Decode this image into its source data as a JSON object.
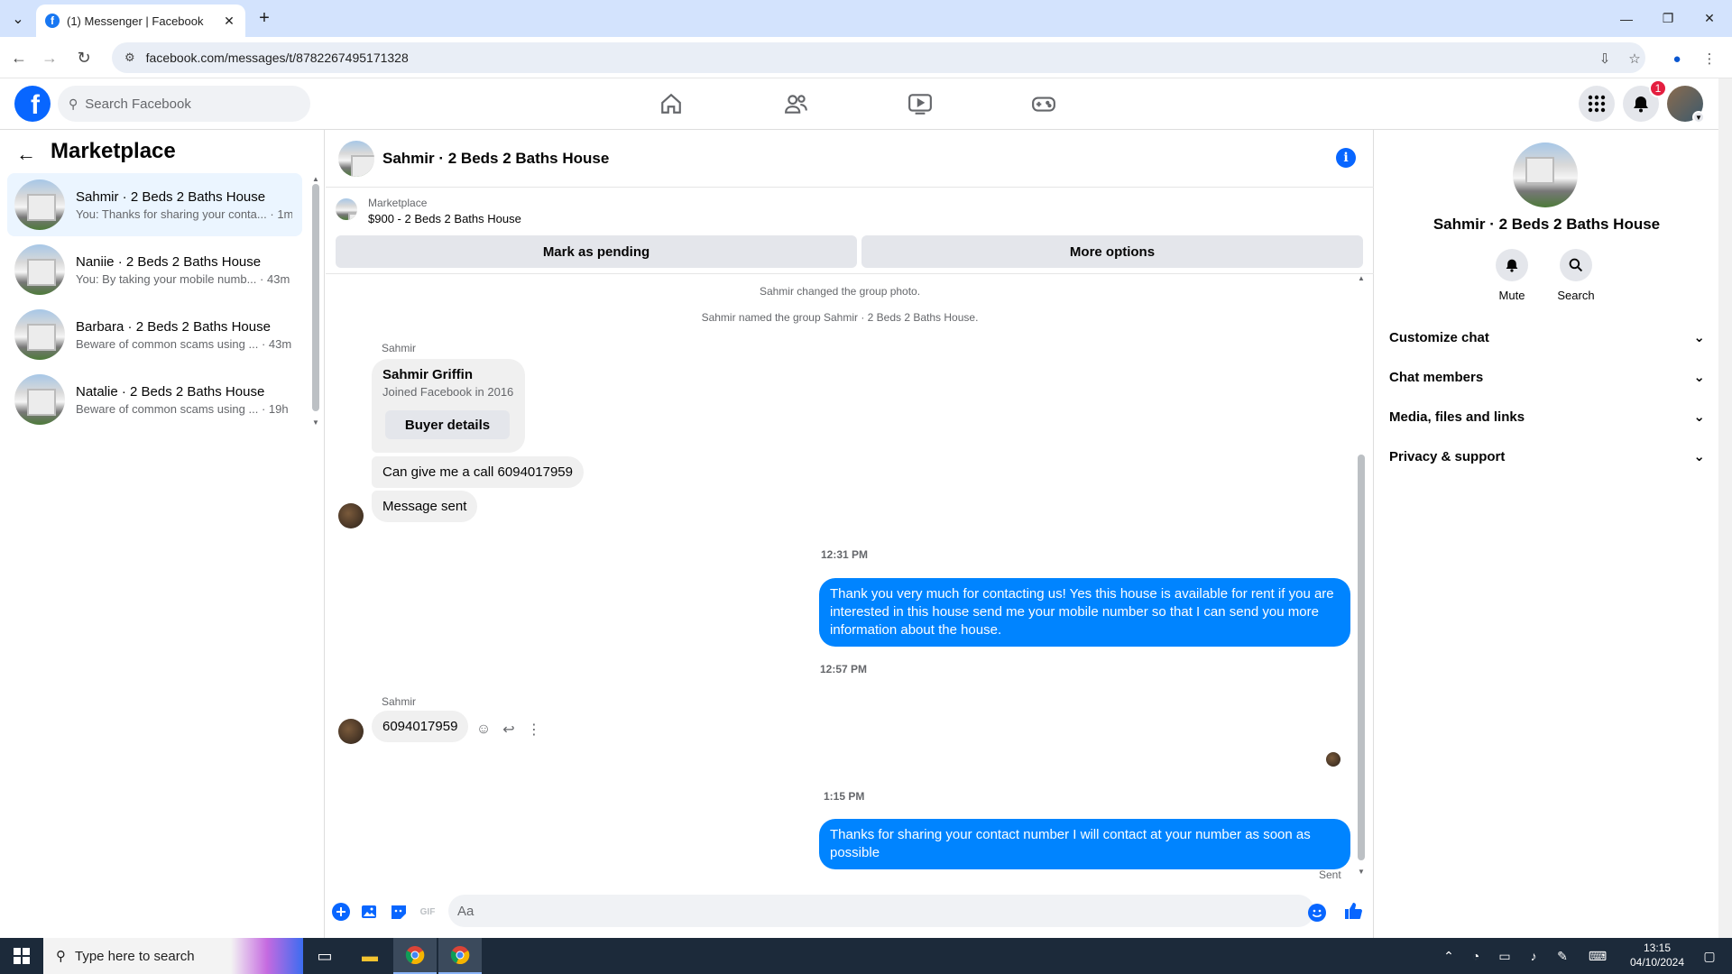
{
  "browser": {
    "tab_title": "(1) Messenger | Facebook",
    "url": "facebook.com/messages/t/8782267495171328"
  },
  "fb_header": {
    "search_placeholder": "Search Facebook",
    "notification_count": "1"
  },
  "left_panel": {
    "heading": "Marketplace",
    "conversations": [
      {
        "name": "Sahmir · 2 Beds 2 Baths House",
        "preview": "You: Thanks for sharing your conta...",
        "time": "· 1m",
        "active": true
      },
      {
        "name": "Naniie · 2 Beds 2 Baths House",
        "preview": "You: By taking your mobile numb...",
        "time": "· 43m",
        "active": false
      },
      {
        "name": "Barbara · 2 Beds 2 Baths House",
        "preview": "Beware of common scams using ...",
        "time": "· 43m",
        "active": false
      },
      {
        "name": "Natalie · 2 Beds 2 Baths House",
        "preview": "Beware of common scams using ...",
        "time": "· 19h",
        "active": false
      }
    ]
  },
  "chat": {
    "title": "Sahmir · 2 Beds 2 Baths House",
    "marketplace_label": "Marketplace",
    "listing": "$900 - 2 Beds 2 Baths House",
    "mark_pending": "Mark as pending",
    "more_options": "More options",
    "sys_photo": "Sahmir changed the group photo.",
    "sys_named": "Sahmir named the group Sahmir · 2 Beds 2 Baths House.",
    "sender_1": "Sahmir",
    "card_name": "Sahmir Griffin",
    "card_joined": "Joined Facebook in 2016",
    "buyer_details": "Buyer details",
    "msg_call": "Can give me a call 6094017959",
    "msg_sent": "Message sent",
    "ts_1": "12:31 PM",
    "mine_1": "Thank you very much for contacting us! Yes this house is available for rent if you are interested in this house send me your mobile number so that I can send you more information about the house.",
    "ts_2": "12:57 PM",
    "sender_2": "Sahmir",
    "msg_number": "6094017959",
    "ts_3": "1:15 PM",
    "mine_2": "Thanks for sharing your contact number I will contact at your number as soon as possible",
    "status": "Sent",
    "composer_placeholder": "Aa"
  },
  "right_panel": {
    "name": "Sahmir · 2 Beds 2 Baths House",
    "mute": "Mute",
    "search": "Search",
    "sections": [
      "Customize chat",
      "Chat members",
      "Media, files and links",
      "Privacy & support"
    ]
  },
  "taskbar": {
    "search_placeholder": "Type here to search",
    "time": "13:15",
    "date": "04/10/2024"
  },
  "colors": {
    "fb_blue": "#0866ff",
    "bubble_blue": "#0084ff",
    "active_bg": "#ebf5ff",
    "badge_red": "#e41e3f"
  }
}
